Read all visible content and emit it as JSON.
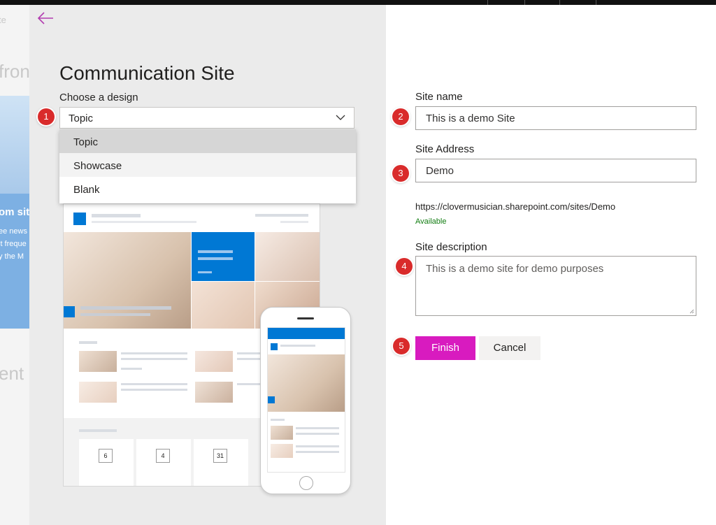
{
  "background": {
    "fragments": [
      "te",
      "fron",
      "om sit",
      "ee news",
      "it freque",
      "y the M",
      "ent s"
    ]
  },
  "panel": {
    "title": "Communication Site",
    "choose_label": "Choose a design",
    "design_select": {
      "value": "Topic",
      "options": [
        "Topic",
        "Showcase",
        "Blank"
      ]
    },
    "preview": {
      "event_dates": [
        "6",
        "4",
        "31"
      ]
    }
  },
  "form": {
    "site_name": {
      "label": "Site name",
      "value": "This is a demo Site"
    },
    "site_address": {
      "label": "Site Address",
      "value": "Demo"
    },
    "url": "https://clovermusician.sharepoint.com/sites/Demo",
    "availability": "Available",
    "site_description": {
      "label": "Site description",
      "value": "This is a demo site for demo purposes"
    },
    "finish_label": "Finish",
    "cancel_label": "Cancel"
  },
  "badges": [
    "1",
    "2",
    "3",
    "4",
    "5"
  ],
  "colors": {
    "accent": "#d81bbf",
    "badge": "#d92b2b",
    "available": "#107c10",
    "preview_blue": "#0078d4"
  }
}
